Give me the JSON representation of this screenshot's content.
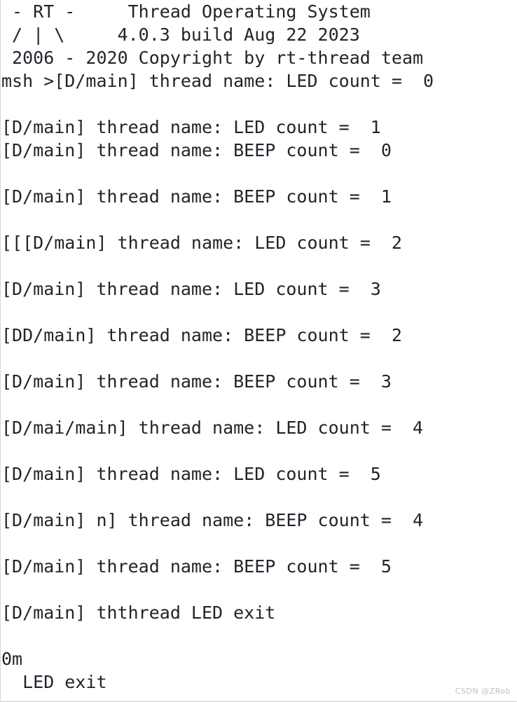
{
  "terminal": {
    "background_color": "#ffffff",
    "text_color": "#21252b",
    "border_color": "#d6d6d6",
    "banner": [
      " - RT -     Thread Operating System",
      " / | \\     4.0.3 build Aug 22 2023",
      " 2006 - 2020 Copyright by rt-thread team"
    ],
    "prompt": "msh >",
    "lines": [
      " - RT -     Thread Operating System",
      " / | \\     4.0.3 build Aug 22 2023",
      " 2006 - 2020 Copyright by rt-thread team",
      "msh >[D/main] thread name: LED count =  0",
      "",
      "[D/main] thread name: LED count =  1",
      "[D/main] thread name: BEEP count =  0",
      "",
      "[D/main] thread name: BEEP count =  1",
      "",
      "[[[D/main] thread name: LED count =  2",
      "",
      "[D/main] thread name: LED count =  3",
      "",
      "[DD/main] thread name: BEEP count =  2",
      "",
      "[D/main] thread name: BEEP count =  3",
      "",
      "[D/mai/main] thread name: LED count =  4",
      "",
      "[D/main] thread name: LED count =  5",
      "",
      "[D/main] n] thread name: BEEP count =  4",
      "",
      "[D/main] thread name: BEEP count =  5",
      "",
      "[D/main] ththread LED exit",
      "",
      "0m",
      "  LED exit"
    ]
  },
  "watermark": {
    "text": "CSDN @ZRob"
  }
}
